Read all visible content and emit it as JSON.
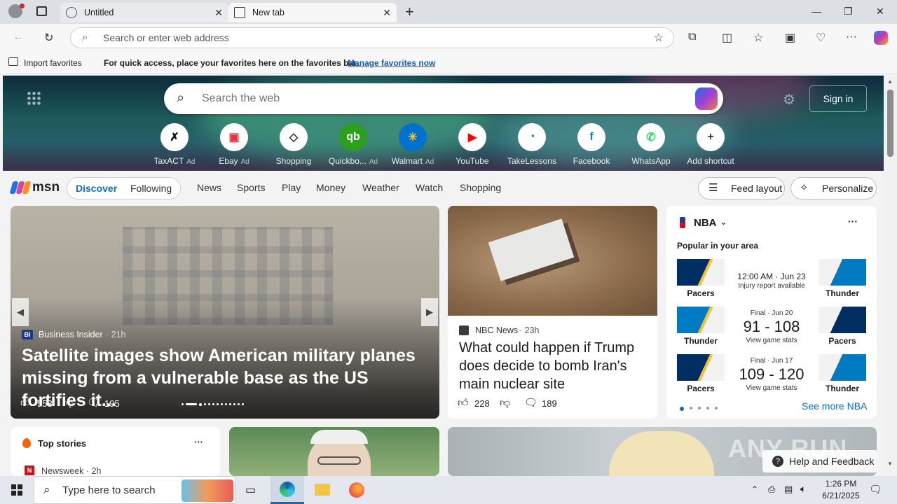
{
  "browser": {
    "tabs": [
      {
        "label": "Untitled"
      },
      {
        "label": "New tab"
      }
    ],
    "new_tab_glyph": "+",
    "address_placeholder": "Search or enter web address"
  },
  "favbar": {
    "import_label": "Import favorites",
    "message": "For quick access, place your favorites here on the favorites bar.",
    "manage_link": "Manage favorites now"
  },
  "hero": {
    "search_placeholder": "Search the web",
    "signin_label": "Sign in",
    "shortcuts": [
      {
        "label": "TaxACT",
        "ad": "Ad",
        "color": "#ffffff",
        "fg": "#111"
      },
      {
        "label": "Ebay",
        "ad": "Ad",
        "color": "#ffffff",
        "fg": "#e53238"
      },
      {
        "label": "Shopping",
        "ad": "",
        "color": "#ffffff",
        "fg": "#333"
      },
      {
        "label": "Quickbo...",
        "ad": "Ad",
        "color": "#2ca01c",
        "fg": "#fff"
      },
      {
        "label": "Walmart",
        "ad": "Ad",
        "color": "#0071ce",
        "fg": "#ffc220"
      },
      {
        "label": "YouTube",
        "ad": "",
        "color": "#ffffff",
        "fg": "#ff0000"
      },
      {
        "label": "TakeLessons",
        "ad": "",
        "color": "#ffffff",
        "fg": "#1b6ec2"
      },
      {
        "label": "Facebook",
        "ad": "",
        "color": "#ffffff",
        "fg": "#1877f2"
      },
      {
        "label": "WhatsApp",
        "ad": "",
        "color": "#ffffff",
        "fg": "#25d366"
      },
      {
        "label": "Add shortcut",
        "ad": "",
        "color": "#ffffff",
        "fg": "#333"
      }
    ]
  },
  "msn": {
    "logo": "msn",
    "tabs": [
      "Discover",
      "Following"
    ],
    "nav": [
      "News",
      "Sports",
      "Play",
      "Money",
      "Weather",
      "Watch",
      "Shopping"
    ],
    "feed_layout": "Feed layout",
    "personalize": "Personalize"
  },
  "story1": {
    "source": "Business Insider",
    "time": "21h",
    "headline": "Satellite images show American military planes missing from a vulnerable base as the US fortifies it...",
    "likes": "553",
    "comments": "195"
  },
  "story2": {
    "source": "NBC News",
    "time": "23h",
    "headline": "What could happen if Trump does decide to bomb Iran's main nuclear site",
    "likes": "228",
    "comments": "189"
  },
  "nba": {
    "title": "NBA",
    "subtitle": "Popular in your area",
    "see_more": "See more NBA",
    "games": [
      {
        "left": "Pacers",
        "right": "Thunder",
        "status": "12:00 AM · Jun 23",
        "note": "Injury report available",
        "score": ""
      },
      {
        "left": "Thunder",
        "right": "Pacers",
        "status": "Final · Jun 20",
        "score": "91 - 108",
        "note": "View game stats"
      },
      {
        "left": "Pacers",
        "right": "Thunder",
        "status": "Final · Jun 17",
        "score": "109 - 120",
        "note": "View game stats"
      }
    ]
  },
  "top_stories": {
    "title": "Top stories",
    "source": "Newsweek",
    "time": "2h"
  },
  "help": "Help and Feedback",
  "watermark": "ANY RUN",
  "taskbar": {
    "search_placeholder": "Type here to search",
    "time": "1:26 PM",
    "date": "6/21/2025"
  }
}
